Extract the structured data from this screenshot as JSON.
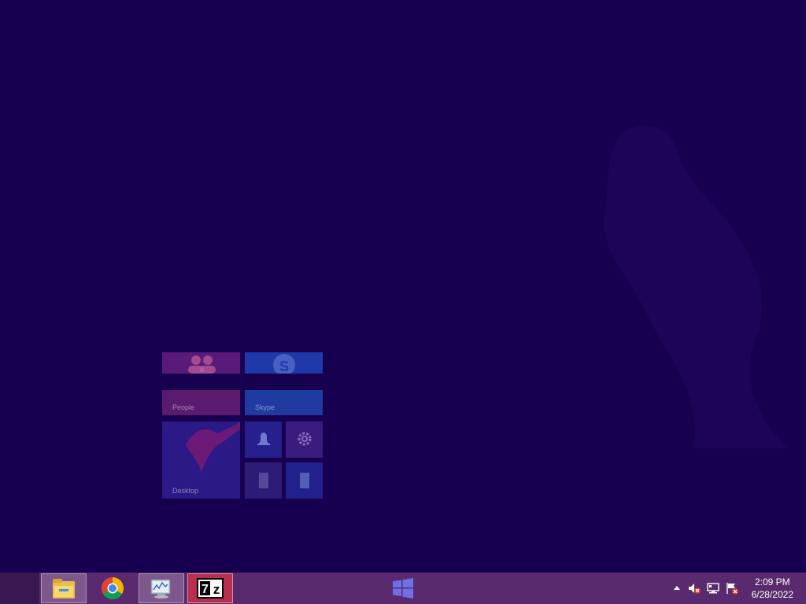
{
  "desktop": {
    "background_color": "#180050"
  },
  "start_screen_tiles": [
    {
      "label": "People",
      "icon": "people-icon"
    },
    {
      "label": "Skype",
      "icon": "skype-icon"
    },
    {
      "label": "Desktop",
      "icon": "desktop-wallpaper-icon"
    },
    {
      "label": "",
      "icon": "alarm-icon"
    },
    {
      "label": "",
      "icon": "settings-icon"
    },
    {
      "label": "",
      "icon": "document-icon"
    },
    {
      "label": "",
      "icon": "document-icon"
    }
  ],
  "taskbar": {
    "background_color": "#5a2a6e",
    "start_button": {
      "icon": "windows-logo-icon"
    },
    "pinned_apps": [
      {
        "name": "File Explorer",
        "icon": "file-explorer-icon"
      },
      {
        "name": "Google Chrome",
        "icon": "chrome-icon"
      },
      {
        "name": "Resource Monitor",
        "icon": "resource-monitor-icon"
      },
      {
        "name": "7-Zip",
        "icon": "7zip-icon",
        "label": "7z"
      }
    ],
    "tray": {
      "icons": [
        "show-hidden-icons-icon",
        "volume-muted-icon",
        "network-icon",
        "action-center-icon"
      ],
      "time": "2:09 PM",
      "date": "6/28/2022"
    }
  }
}
